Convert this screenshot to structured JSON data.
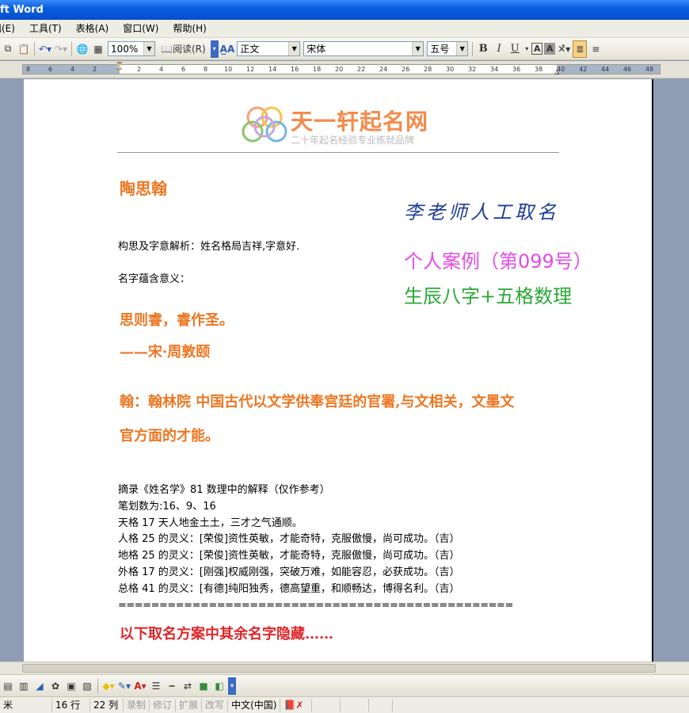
{
  "window": {
    "title": "ft Word"
  },
  "menu": {
    "items": [
      "编辑(E)",
      "工具(T)",
      "表格(A)",
      "窗口(W)",
      "帮助(H)"
    ]
  },
  "toolbar": {
    "zoom": "100%",
    "read_label": "阅读(R)",
    "style": "正文",
    "font": "宋体",
    "size": "五号",
    "bold": "B",
    "italic": "I",
    "underline": "U",
    "highlight": "A",
    "char_shade": "A"
  },
  "ruler": {
    "ticks": [
      "8",
      "6",
      "4",
      "2",
      "2",
      "4",
      "6",
      "8",
      "10",
      "12",
      "14",
      "16",
      "18",
      "20",
      "22",
      "24",
      "26",
      "28",
      "30",
      "32",
      "34",
      "36",
      "38",
      "40",
      "42",
      "44",
      "46",
      "48"
    ]
  },
  "logo": {
    "title": "天一轩起名网",
    "subtitle": "二十年起名经验专业练就品牌"
  },
  "doc": {
    "name_title": "陶思翰",
    "teacher": "李老师人工取名",
    "case": "个人案例（第099号）",
    "bazi": "生辰八字+五格数理",
    "analysis": "构思及字意解析：姓名格局吉祥,字意好.",
    "meaning_label": "名字蕴含意义：",
    "quote_line1": "思则睿，睿作圣。",
    "quote_line2": "——宋·周敦颐",
    "han_line1": "翰：翰林院 中国古代以文学供奉宫廷的官署,与文相关，文墨文",
    "han_line2": "官方面的才能。",
    "num_lines": [
      "摘录《姓名学》81 数理中的解释（仅作参考）",
      "笔划数为:16、9、16",
      "天格 17 天人地金土土，三才之气通顺。",
      "人格 25 的灵义：[荣俊]资性英敏，才能奇特，克服傲慢，尚可成功。（吉）",
      "地格 25 的灵义：[荣俊]资性英敏，才能奇特，克服傲慢，尚可成功。（吉）",
      "外格 17 的灵义：[刚强]权威刚强，突破万难，如能容忍，必获成功。（吉）",
      "总格 41 的灵义：[有德]纯阳独秀，德高望重，和顺畅达，博得名利。（吉）",
      "================================================"
    ],
    "hidden_note": "以下取名方案中其余名字隐藏……"
  },
  "status": {
    "page": "米",
    "row": "16 行",
    "col": "22 列",
    "rec": "录制",
    "trk": "修订",
    "ext": "扩展",
    "ovr": "改写",
    "lang": "中文(中国)"
  }
}
